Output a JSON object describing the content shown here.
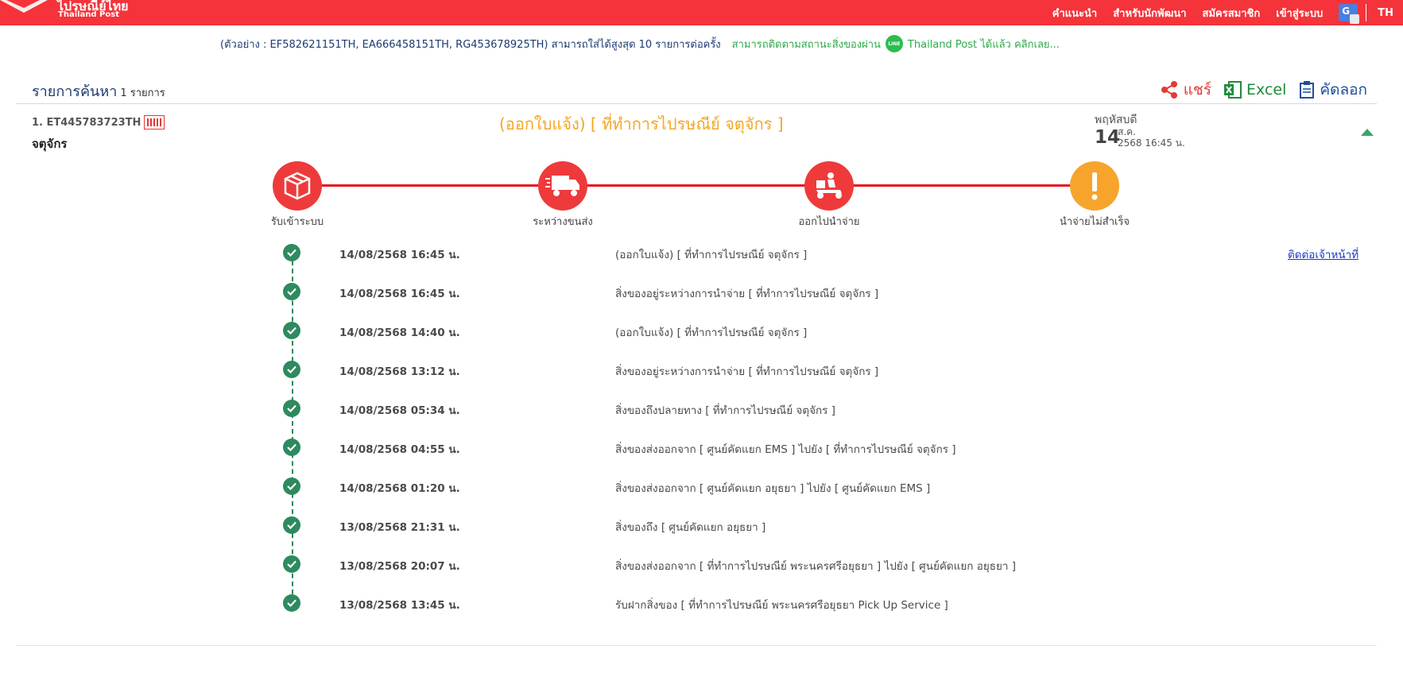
{
  "header": {
    "logo_th": "ไปรษณีย์ไทย",
    "logo_en": "Thailand Post",
    "nav": [
      "คำแนะนำ",
      "สำหรับนักพัฒนา",
      "สมัครสมาชิก",
      "เข้าสู่ระบบ"
    ],
    "translate_icon": "google-translate-icon",
    "language": "TH"
  },
  "hint": {
    "example": "(ตัวอย่าง : EF582621151TH, EA666458151TH, RG453678925TH) สามารถใส่ได้สูงสุด 10 รายการต่อครั้ง",
    "line_prefix": "สามารถติดตามสถานะสิ่งของผ่าน",
    "line_badge": "LINE",
    "line_suffix": "Thailand Post ได้แล้ว คลิกเลย..."
  },
  "results": {
    "title": "รายการค้นหา",
    "count": "1 รายการ",
    "share_label": "แชร์",
    "excel_label": "Excel",
    "copy_label": "คัดลอก"
  },
  "item": {
    "number": "1. ET445783723TH",
    "place": "จตุจักร",
    "status": "(ออกใบแจ้ง) [ ที่ทำการไปรษณีย์ จตุจักร ]",
    "day_of_week": "พฤหัสบดี",
    "day": "14",
    "month": "ส.ค.",
    "year_time": "2568  16:45 น."
  },
  "steps": [
    {
      "label": "รับเข้าระบบ",
      "icon": "box-icon"
    },
    {
      "label": "ระหว่างขนส่ง",
      "icon": "truck-icon"
    },
    {
      "label": "ออกไปนำจ่าย",
      "icon": "scooter-icon"
    },
    {
      "label": "นำจ่ายไม่สำเร็จ",
      "icon": "exclamation-icon"
    }
  ],
  "contact_link": "ติดต่อเจ้าหน้าที่",
  "events": [
    {
      "datetime": "14/08/2568 16:45 น.",
      "description": "(ออกใบแจ้ง) [ ที่ทำการไปรษณีย์ จตุจักร ]"
    },
    {
      "datetime": "14/08/2568 16:45 น.",
      "description": "สิ่งของอยู่ระหว่างการนำจ่าย [ ที่ทำการไปรษณีย์ จตุจักร ]"
    },
    {
      "datetime": "14/08/2568 14:40 น.",
      "description": "(ออกใบแจ้ง) [ ที่ทำการไปรษณีย์ จตุจักร ]"
    },
    {
      "datetime": "14/08/2568 13:12 น.",
      "description": "สิ่งของอยู่ระหว่างการนำจ่าย [ ที่ทำการไปรษณีย์ จตุจักร ]"
    },
    {
      "datetime": "14/08/2568 05:34 น.",
      "description": "สิ่งของถึงปลายทาง [ ที่ทำการไปรษณีย์ จตุจักร ]"
    },
    {
      "datetime": "14/08/2568 04:55 น.",
      "description": "สิ่งของส่งออกจาก [ ศูนย์คัดแยก EMS ] ไปยัง [ ที่ทำการไปรษณีย์ จตุจักร ]"
    },
    {
      "datetime": "14/08/2568 01:20 น.",
      "description": "สิ่งของส่งออกจาก [ ศูนย์คัดแยก อยุธยา ] ไปยัง [ ศูนย์คัดแยก EMS ]"
    },
    {
      "datetime": "13/08/2568 21:31 น.",
      "description": "สิ่งของถึง [ ศูนย์คัดแยก อยุธยา ]"
    },
    {
      "datetime": "13/08/2568 20:07 น.",
      "description": "สิ่งของส่งออกจาก [ ที่ทำการไปรษณีย์ พระนครศรีอยุธยา ] ไปยัง [ ศูนย์คัดแยก อยุธยา ]"
    },
    {
      "datetime": "13/08/2568 13:45 น.",
      "description": "รับฝากสิ่งของ [ ที่ทำการไปรษณีย์ พระนครศรีอยุธยา Pick Up Service ]"
    }
  ]
}
